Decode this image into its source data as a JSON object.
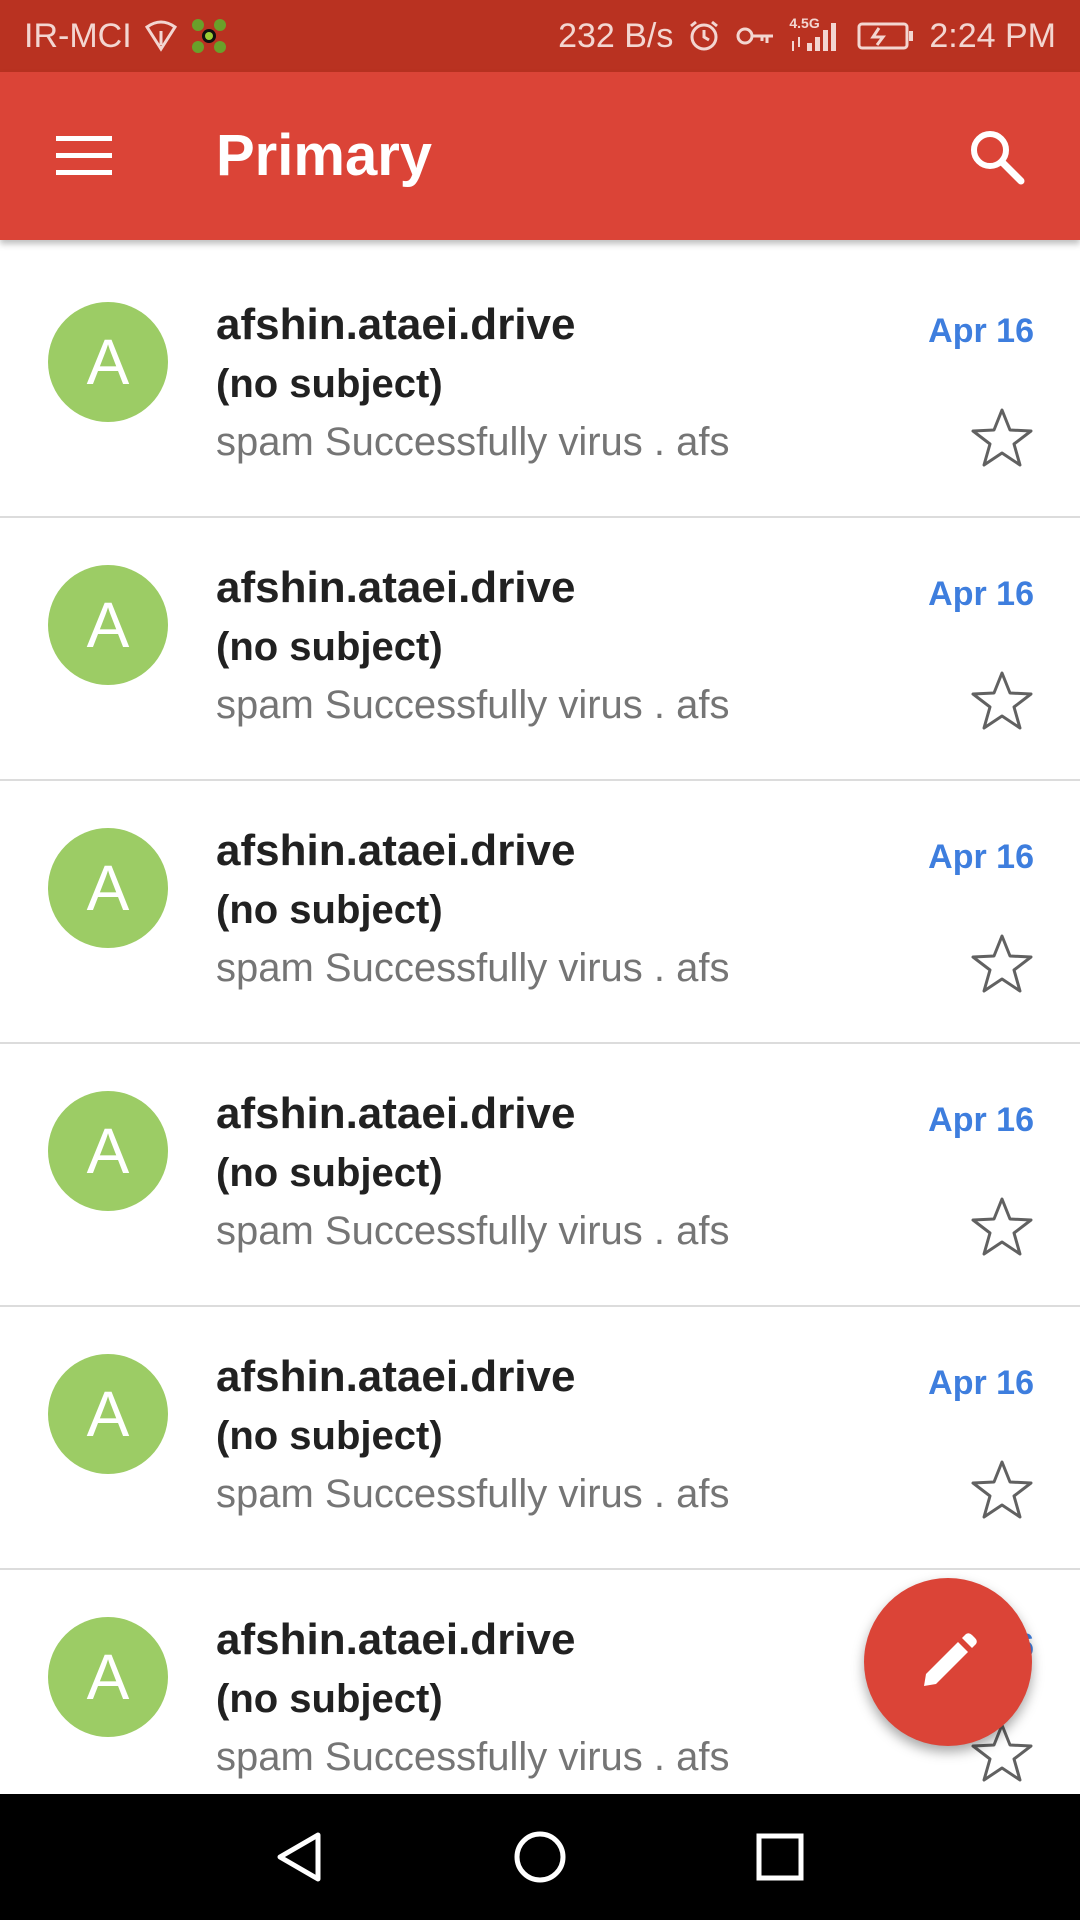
{
  "status_bar": {
    "carrier": "IR-MCI",
    "net_speed": "232 B/s",
    "network_type": "4.5G",
    "time": "2:24 PM",
    "icons": [
      "signal-wifi-icon",
      "app-notification-icon",
      "alarm-icon",
      "vpn-key-icon",
      "cellular-signal-icon",
      "battery-charging-icon"
    ]
  },
  "app_bar": {
    "title": "Primary",
    "menu_icon": "hamburger-menu-icon",
    "search_icon": "search-icon"
  },
  "emails": [
    {
      "avatar_letter": "A",
      "sender": "afshin.ataei.drive",
      "subject": "(no subject)",
      "snippet": "spam Successfully virus . afs",
      "date": "Apr 16",
      "starred": false
    },
    {
      "avatar_letter": "A",
      "sender": "afshin.ataei.drive",
      "subject": "(no subject)",
      "snippet": "spam Successfully virus . afs",
      "date": "Apr 16",
      "starred": false
    },
    {
      "avatar_letter": "A",
      "sender": "afshin.ataei.drive",
      "subject": "(no subject)",
      "snippet": "spam Successfully virus . afs",
      "date": "Apr 16",
      "starred": false
    },
    {
      "avatar_letter": "A",
      "sender": "afshin.ataei.drive",
      "subject": "(no subject)",
      "snippet": "spam Successfully virus . afs",
      "date": "Apr 16",
      "starred": false
    },
    {
      "avatar_letter": "A",
      "sender": "afshin.ataei.drive",
      "subject": "(no subject)",
      "snippet": "spam Successfully virus . afs",
      "date": "Apr 16",
      "starred": false
    },
    {
      "avatar_letter": "A",
      "sender": "afshin.ataei.drive",
      "subject": "(no subject)",
      "snippet": "spam Successfully virus . afs",
      "date": "Apr 16",
      "starred": false
    }
  ],
  "fab": {
    "icon": "compose-pencil-icon"
  },
  "colors": {
    "accent": "#db4437",
    "status_bar": "#b93221",
    "avatar": "#9ccc65",
    "date": "#3e7ede"
  },
  "nav_bar": {
    "icons": [
      "back-icon",
      "home-icon",
      "recents-icon"
    ]
  }
}
